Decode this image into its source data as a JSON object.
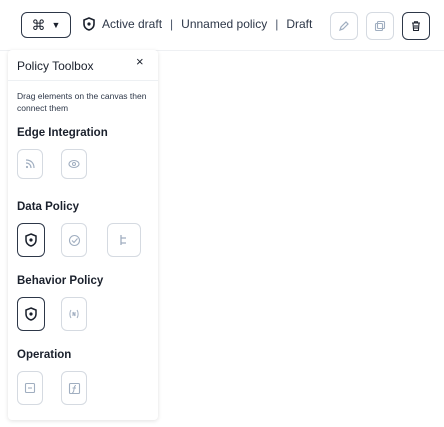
{
  "toolbar": {
    "mode_icon": "command-icon",
    "status_parts": [
      "Active draft",
      "Unnamed policy",
      "Draft"
    ],
    "separator": "|",
    "buttons": [
      {
        "name": "edit-button",
        "icon": "pencil-icon"
      },
      {
        "name": "copy-button",
        "icon": "copy-icon"
      },
      {
        "name": "delete-button",
        "icon": "trash-icon"
      }
    ]
  },
  "toolbox": {
    "title": "Policy Toolbox",
    "close_label": "×",
    "hint": "Drag elements on the canvas then connect them",
    "sections": [
      {
        "title": "Edge Integration",
        "items": [
          "rss-icon",
          "plugin-icon"
        ]
      },
      {
        "title": "Data Policy",
        "items": [
          "data-policy-icon",
          "verified-icon",
          "hierarchy-icon"
        ]
      },
      {
        "title": "Behavior Policy",
        "items": [
          "behavior-policy-icon",
          "state-icon"
        ]
      },
      {
        "title": "Operation",
        "items": [
          "operation-icon",
          "function-icon"
        ]
      }
    ]
  },
  "colors": {
    "text": "#1a202c",
    "border": "#d5dae1",
    "active_border": "#2d3748",
    "muted_icon": "#a0aec0"
  }
}
